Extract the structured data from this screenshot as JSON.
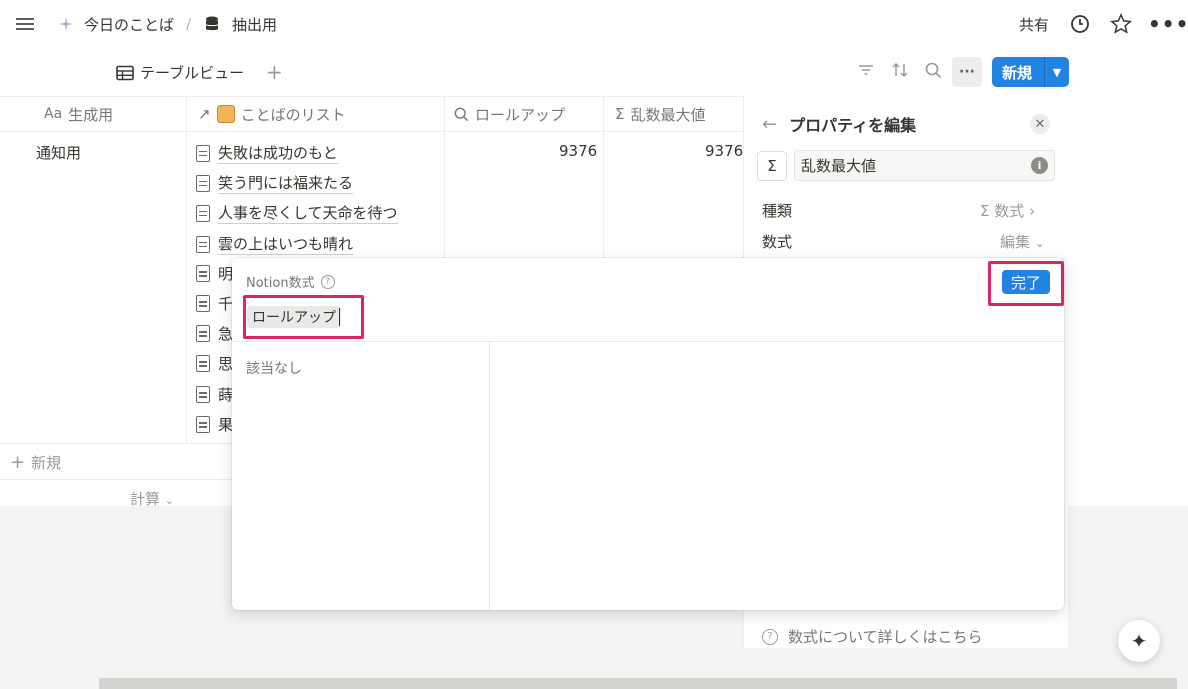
{
  "topbar": {
    "breadcrumb_page": "今日のことば",
    "breadcrumb_sep": "/",
    "breadcrumb_db": "抽出用",
    "share": "共有"
  },
  "viewbar": {
    "view_tab": "テーブルビュー",
    "new_button": "新規"
  },
  "table": {
    "columns": [
      {
        "icon": "Aa",
        "label": "生成用"
      },
      {
        "icon": "↗",
        "label": "ことばのリスト"
      },
      {
        "icon": "search-icon",
        "label": "ロールアップ"
      },
      {
        "icon": "Σ",
        "label": "乱数最大値"
      }
    ],
    "row_title": "通知用",
    "rollup_value": "9376",
    "max_value": "9376",
    "pages": [
      "失敗は成功のもと",
      "笑う門には福来たる",
      "人事を尽くして天命を待つ",
      "雲の上はいつも晴れ",
      "明",
      "千",
      "急",
      "思",
      "蒔",
      "果"
    ],
    "add_row": "新規",
    "calculate": "計算"
  },
  "panel": {
    "title": "プロパティを編集",
    "property_name": "乱数最大値",
    "type_label": "種類",
    "type_value": "数式",
    "formula_label": "数式",
    "formula_value": "編集",
    "help_text": "数式について詳しくはこちら"
  },
  "popup": {
    "label": "Notion数式",
    "formula_token": "ロールアップ",
    "done": "完了",
    "no_match": "該当なし"
  },
  "colors": {
    "accent": "#2383e2",
    "highlight": "#e0245e"
  }
}
